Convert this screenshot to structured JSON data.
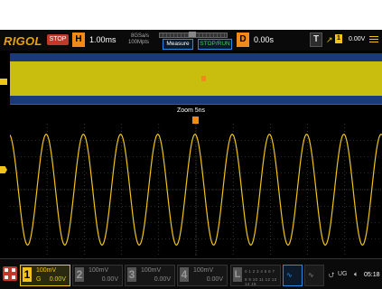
{
  "brand": "RIGOL",
  "run_state": "STOP",
  "horizontal": {
    "key": "H",
    "timebase": "1.00ms",
    "sample_rate": "8GSa/s",
    "mem_depth": "100Mpts"
  },
  "buttons": {
    "measure": "Measure",
    "stop_run": "STOP/RUN"
  },
  "delay": {
    "key": "D",
    "value": "0.00s"
  },
  "trigger": {
    "key": "T",
    "source": "1",
    "level": "0.00V"
  },
  "zoom": {
    "label": "Zoom 5ns"
  },
  "channels": [
    {
      "num": "1",
      "scale": "100mV",
      "offset": "0.00V",
      "coupling": "G",
      "active": true,
      "color": "#f0c419"
    },
    {
      "num": "2",
      "scale": "100mV",
      "offset": "0.00V",
      "active": false
    },
    {
      "num": "3",
      "scale": "100mV",
      "offset": "0.00V",
      "active": false
    },
    {
      "num": "4",
      "scale": "100mV",
      "offset": "0.00V",
      "active": false
    }
  ],
  "logic": {
    "key": "L",
    "digits_top": "0 1 2 3 4 5 6 7",
    "digits_bottom": "8 9 10 11 12 13 14 15"
  },
  "status": {
    "usb": "UG",
    "time": "05:18"
  },
  "waveform": {
    "cycles_on_screen": 10,
    "amplitude_fraction": 0.42,
    "color": "#f0c419"
  },
  "colors": {
    "background": "#000000",
    "accent": "#f08a1a",
    "trace": "#f0c419",
    "overview_bg": "#1b3a7c"
  }
}
